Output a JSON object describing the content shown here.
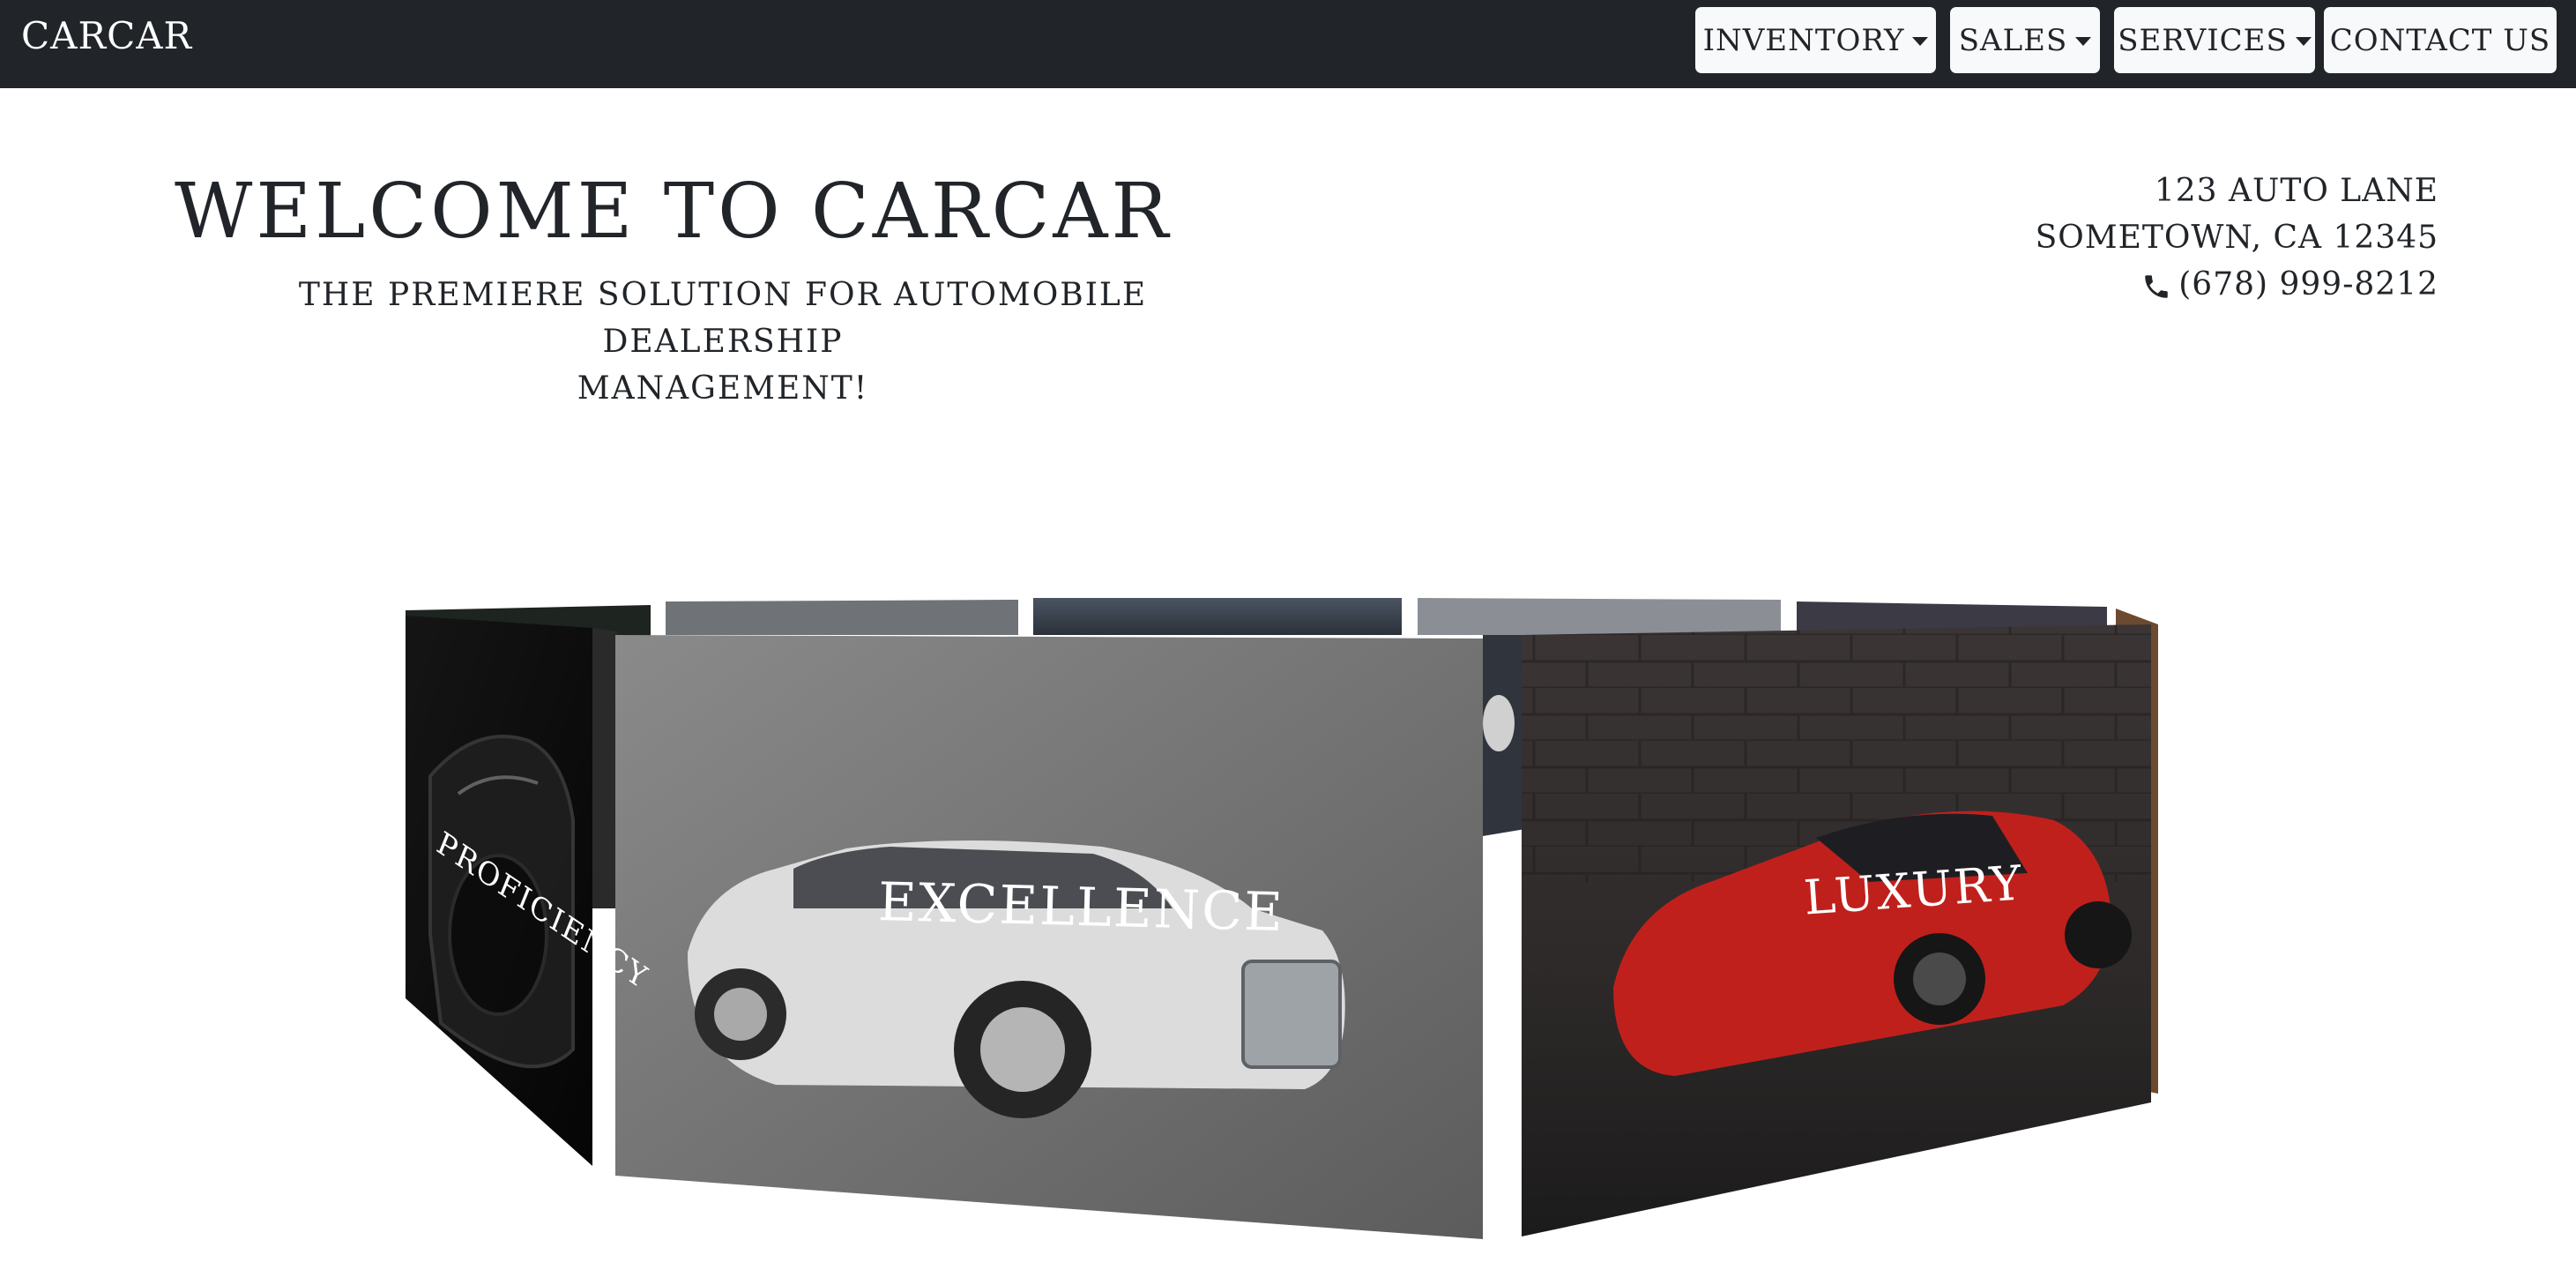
{
  "navbar": {
    "brand": "CARCAR",
    "items": [
      {
        "label": "INVENTORY",
        "dropdown": true
      },
      {
        "label": "SALES",
        "dropdown": true
      },
      {
        "label": "SERVICES",
        "dropdown": true
      },
      {
        "label": "CONTACT US",
        "dropdown": false
      }
    ]
  },
  "hero": {
    "title": "WELCOME TO CARCAR",
    "subtitle_line1": "THE PREMIERE SOLUTION FOR AUTOMOBILE DEALERSHIP",
    "subtitle_line2": "MANAGEMENT!"
  },
  "contact": {
    "street": "123 AUTO LANE",
    "city": "SOMETOWN, CA 12345",
    "phone": "(678) 999-8212",
    "phone_icon": "phone-icon"
  },
  "carousel": {
    "panels": [
      {
        "caption": "PROFICIENCY",
        "car": "black hypercar"
      },
      {
        "caption": "EXCELLENCE",
        "car": "white luxury sedan"
      },
      {
        "caption": "LUXURY",
        "car": "red sports car"
      }
    ]
  },
  "colors": {
    "navbar_bg": "#212529",
    "nav_button_bg": "#f8f9fa",
    "text": "#212529",
    "page_bg": "#ffffff"
  }
}
